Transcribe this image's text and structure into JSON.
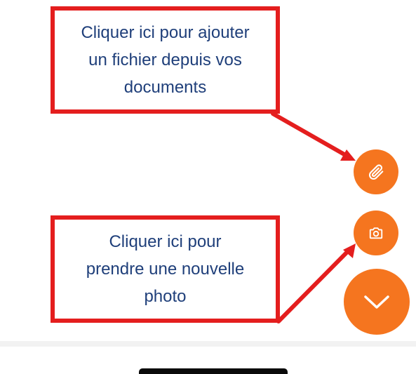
{
  "callouts": {
    "attach": {
      "line1": "Cliquer ici pour ajouter",
      "line2": "un fichier depuis vos",
      "line3": "documents"
    },
    "camera": {
      "line1": "Cliquer ici pour",
      "line2": "prendre une nouvelle",
      "line3": "photo"
    }
  },
  "fabs": {
    "attach_icon": "paperclip-icon",
    "camera_icon": "camera-icon",
    "toggle_icon": "chevron-down-icon"
  },
  "colors": {
    "accent": "#f5751f",
    "callout_border": "#e41e1e",
    "callout_text": "#1f3f7a",
    "arrow": "#e41e1e"
  }
}
